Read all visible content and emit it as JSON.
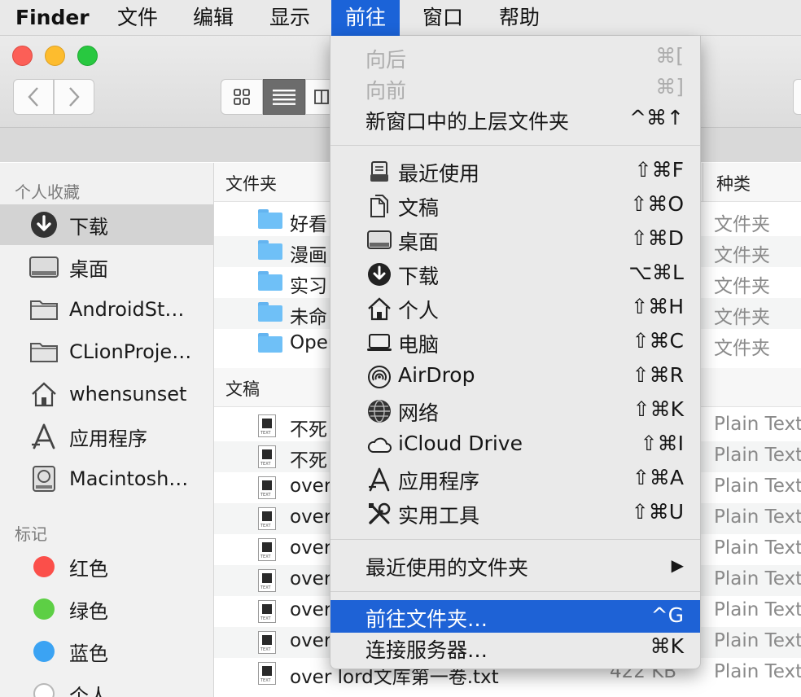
{
  "menubar": {
    "items": [
      "Finder",
      "文件",
      "编辑",
      "显示",
      "前往",
      "窗口",
      "帮助"
    ],
    "active": "前往"
  },
  "sidebar": {
    "favorites_heading": "个人收藏",
    "favorites": [
      {
        "label": "下载",
        "icon": "download-icon"
      },
      {
        "label": "桌面",
        "icon": "desktop-icon"
      },
      {
        "label": "AndroidSt…",
        "icon": "folder-icon"
      },
      {
        "label": "CLionProje…",
        "icon": "folder-icon"
      },
      {
        "label": "whensunset",
        "icon": "home-icon"
      },
      {
        "label": "应用程序",
        "icon": "applications-icon"
      },
      {
        "label": "Macintosh…",
        "icon": "hard-drive-icon"
      }
    ],
    "tags_heading": "标记",
    "tags": [
      {
        "label": "红色",
        "color": "#fb4f4a"
      },
      {
        "label": "绿色",
        "color": "#5dcf45"
      },
      {
        "label": "蓝色",
        "color": "#3ba3f3"
      },
      {
        "label": "个人",
        "color": "#ffffff"
      }
    ]
  },
  "main": {
    "kind_header": "种类",
    "folders_section": {
      "title": "文件夹",
      "rows": [
        {
          "name": "好看",
          "kind": "文件夹"
        },
        {
          "name": "漫画",
          "kind": "文件夹"
        },
        {
          "name": "实习",
          "kind": "文件夹"
        },
        {
          "name": "未命",
          "kind": "文件夹"
        },
        {
          "name": "Oper",
          "kind": "文件夹"
        }
      ]
    },
    "docs_section": {
      "title": "文稿",
      "rows": [
        {
          "name": "不死",
          "size": "",
          "kind": "Plain Text"
        },
        {
          "name": "不死",
          "size": "",
          "kind": "Plain Text"
        },
        {
          "name": "over",
          "size": "",
          "kind": "Plain Text"
        },
        {
          "name": "over",
          "size": "",
          "kind": "Plain Text"
        },
        {
          "name": "over",
          "size": "",
          "kind": "Plain Text"
        },
        {
          "name": "over",
          "size": "",
          "kind": "Plain Text"
        },
        {
          "name": "over",
          "size": "",
          "kind": "Plain Text"
        },
        {
          "name": "over",
          "size": "",
          "kind": "Plain Text"
        },
        {
          "name": "over lord文库第一卷.txt",
          "size": "422 KB",
          "kind": "Plain Text"
        }
      ]
    }
  },
  "menu": {
    "items": [
      {
        "label": "向后",
        "shortcut": "⌘[",
        "disabled": true
      },
      {
        "label": "向前",
        "shortcut": "⌘]",
        "disabled": true
      },
      {
        "label": "新窗口中的上层文件夹",
        "shortcut": "^⌘↑"
      },
      {
        "label": "最近使用",
        "shortcut": "⇧⌘F",
        "icon": "recents-icon"
      },
      {
        "label": "文稿",
        "shortcut": "⇧⌘O",
        "icon": "documents-icon"
      },
      {
        "label": "桌面",
        "shortcut": "⇧⌘D",
        "icon": "desktop-icon"
      },
      {
        "label": "下载",
        "shortcut": "⌥⌘L",
        "icon": "download-icon"
      },
      {
        "label": "个人",
        "shortcut": "⇧⌘H",
        "icon": "home-icon"
      },
      {
        "label": "电脑",
        "shortcut": "⇧⌘C",
        "icon": "computer-icon"
      },
      {
        "label": "AirDrop",
        "shortcut": "⇧⌘R",
        "icon": "airdrop-icon"
      },
      {
        "label": "网络",
        "shortcut": "⇧⌘K",
        "icon": "network-icon"
      },
      {
        "label": "iCloud Drive",
        "shortcut": "⇧⌘I",
        "icon": "icloud-icon"
      },
      {
        "label": "应用程序",
        "shortcut": "⇧⌘A",
        "icon": "applications-icon"
      },
      {
        "label": "实用工具",
        "shortcut": "⇧⌘U",
        "icon": "utilities-icon"
      },
      {
        "label": "最近使用的文件夹",
        "shortcut": "▶"
      },
      {
        "label": "前往文件夹…",
        "shortcut": "^G",
        "highlighted": true
      },
      {
        "label": "连接服务器…",
        "shortcut": "⌘K"
      }
    ]
  }
}
